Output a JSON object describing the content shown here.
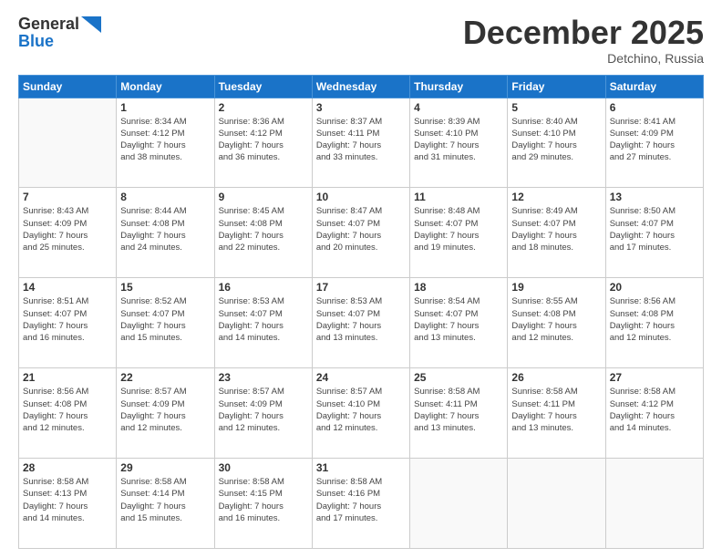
{
  "logo": {
    "line1": "General",
    "line2": "Blue"
  },
  "title": "December 2025",
  "subtitle": "Detchino, Russia",
  "weekdays": [
    "Sunday",
    "Monday",
    "Tuesday",
    "Wednesday",
    "Thursday",
    "Friday",
    "Saturday"
  ],
  "weeks": [
    [
      {
        "day": "",
        "info": ""
      },
      {
        "day": "1",
        "info": "Sunrise: 8:34 AM\nSunset: 4:12 PM\nDaylight: 7 hours\nand 38 minutes."
      },
      {
        "day": "2",
        "info": "Sunrise: 8:36 AM\nSunset: 4:12 PM\nDaylight: 7 hours\nand 36 minutes."
      },
      {
        "day": "3",
        "info": "Sunrise: 8:37 AM\nSunset: 4:11 PM\nDaylight: 7 hours\nand 33 minutes."
      },
      {
        "day": "4",
        "info": "Sunrise: 8:39 AM\nSunset: 4:10 PM\nDaylight: 7 hours\nand 31 minutes."
      },
      {
        "day": "5",
        "info": "Sunrise: 8:40 AM\nSunset: 4:10 PM\nDaylight: 7 hours\nand 29 minutes."
      },
      {
        "day": "6",
        "info": "Sunrise: 8:41 AM\nSunset: 4:09 PM\nDaylight: 7 hours\nand 27 minutes."
      }
    ],
    [
      {
        "day": "7",
        "info": "Sunrise: 8:43 AM\nSunset: 4:09 PM\nDaylight: 7 hours\nand 25 minutes."
      },
      {
        "day": "8",
        "info": "Sunrise: 8:44 AM\nSunset: 4:08 PM\nDaylight: 7 hours\nand 24 minutes."
      },
      {
        "day": "9",
        "info": "Sunrise: 8:45 AM\nSunset: 4:08 PM\nDaylight: 7 hours\nand 22 minutes."
      },
      {
        "day": "10",
        "info": "Sunrise: 8:47 AM\nSunset: 4:07 PM\nDaylight: 7 hours\nand 20 minutes."
      },
      {
        "day": "11",
        "info": "Sunrise: 8:48 AM\nSunset: 4:07 PM\nDaylight: 7 hours\nand 19 minutes."
      },
      {
        "day": "12",
        "info": "Sunrise: 8:49 AM\nSunset: 4:07 PM\nDaylight: 7 hours\nand 18 minutes."
      },
      {
        "day": "13",
        "info": "Sunrise: 8:50 AM\nSunset: 4:07 PM\nDaylight: 7 hours\nand 17 minutes."
      }
    ],
    [
      {
        "day": "14",
        "info": "Sunrise: 8:51 AM\nSunset: 4:07 PM\nDaylight: 7 hours\nand 16 minutes."
      },
      {
        "day": "15",
        "info": "Sunrise: 8:52 AM\nSunset: 4:07 PM\nDaylight: 7 hours\nand 15 minutes."
      },
      {
        "day": "16",
        "info": "Sunrise: 8:53 AM\nSunset: 4:07 PM\nDaylight: 7 hours\nand 14 minutes."
      },
      {
        "day": "17",
        "info": "Sunrise: 8:53 AM\nSunset: 4:07 PM\nDaylight: 7 hours\nand 13 minutes."
      },
      {
        "day": "18",
        "info": "Sunrise: 8:54 AM\nSunset: 4:07 PM\nDaylight: 7 hours\nand 13 minutes."
      },
      {
        "day": "19",
        "info": "Sunrise: 8:55 AM\nSunset: 4:08 PM\nDaylight: 7 hours\nand 12 minutes."
      },
      {
        "day": "20",
        "info": "Sunrise: 8:56 AM\nSunset: 4:08 PM\nDaylight: 7 hours\nand 12 minutes."
      }
    ],
    [
      {
        "day": "21",
        "info": "Sunrise: 8:56 AM\nSunset: 4:08 PM\nDaylight: 7 hours\nand 12 minutes."
      },
      {
        "day": "22",
        "info": "Sunrise: 8:57 AM\nSunset: 4:09 PM\nDaylight: 7 hours\nand 12 minutes."
      },
      {
        "day": "23",
        "info": "Sunrise: 8:57 AM\nSunset: 4:09 PM\nDaylight: 7 hours\nand 12 minutes."
      },
      {
        "day": "24",
        "info": "Sunrise: 8:57 AM\nSunset: 4:10 PM\nDaylight: 7 hours\nand 12 minutes."
      },
      {
        "day": "25",
        "info": "Sunrise: 8:58 AM\nSunset: 4:11 PM\nDaylight: 7 hours\nand 13 minutes."
      },
      {
        "day": "26",
        "info": "Sunrise: 8:58 AM\nSunset: 4:11 PM\nDaylight: 7 hours\nand 13 minutes."
      },
      {
        "day": "27",
        "info": "Sunrise: 8:58 AM\nSunset: 4:12 PM\nDaylight: 7 hours\nand 14 minutes."
      }
    ],
    [
      {
        "day": "28",
        "info": "Sunrise: 8:58 AM\nSunset: 4:13 PM\nDaylight: 7 hours\nand 14 minutes."
      },
      {
        "day": "29",
        "info": "Sunrise: 8:58 AM\nSunset: 4:14 PM\nDaylight: 7 hours\nand 15 minutes."
      },
      {
        "day": "30",
        "info": "Sunrise: 8:58 AM\nSunset: 4:15 PM\nDaylight: 7 hours\nand 16 minutes."
      },
      {
        "day": "31",
        "info": "Sunrise: 8:58 AM\nSunset: 4:16 PM\nDaylight: 7 hours\nand 17 minutes."
      },
      {
        "day": "",
        "info": ""
      },
      {
        "day": "",
        "info": ""
      },
      {
        "day": "",
        "info": ""
      }
    ]
  ]
}
